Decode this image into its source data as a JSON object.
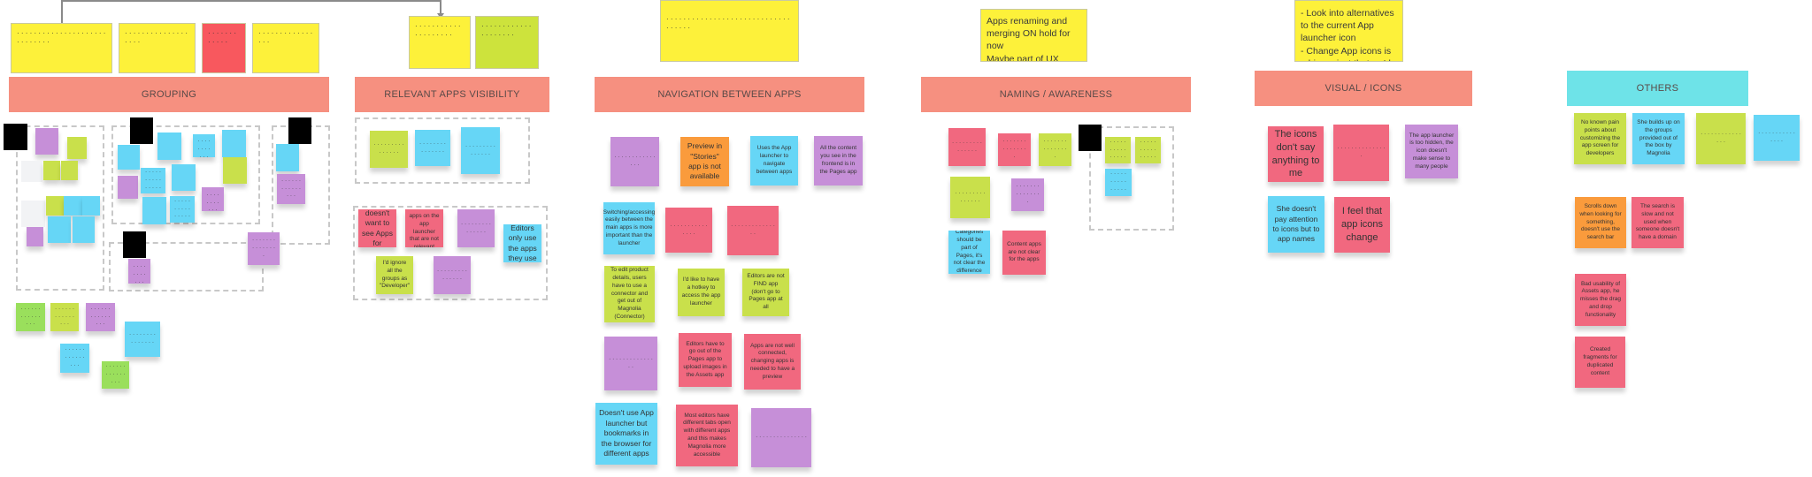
{
  "board": {
    "colors": {
      "header": "#f69080",
      "header_others": "#6ee3e8",
      "note_yellow": "#fdf13a",
      "note_red": "#f8585e",
      "note_lime": "#cde33c",
      "sticky_purple": "#c68fd8",
      "sticky_lime": "#c9e04b",
      "sticky_blue": "#66d6f6",
      "sticky_pink": "#f1687f",
      "sticky_orange": "#fa9b3c",
      "sticky_green": "#9adf5c"
    },
    "headers": {
      "grouping": "GROUPING",
      "relevant_apps_visibility": "RELEVANT APPS VISIBILITY",
      "navigation_between_apps": "NAVIGATION BETWEEN APPS",
      "naming_awareness": "NAMING / AWARENESS",
      "visual_icons": "VISUAL / ICONS",
      "others": "OTHERS"
    },
    "top_notes": {
      "grouping_1": "· · · · · · · · · · · · · · · · · · · · · · · · · · · · ·",
      "grouping_2": "· · · · · · · · · · · · · · · · · · ·",
      "grouping_3": "· · · · · · · · · · · ·",
      "grouping_4": "· · · · · · · · · · · · · · · ·",
      "relevant_1": "· · · · · · · · · · · · · · · · · · · ·",
      "relevant_2": "· · · · · · · · · · · · · · · · · · · ·",
      "navigation_1": "· · · · · · · · · · · · · · · · · · · · · · · · · · · · · · · · · · ·",
      "naming_1": "Apps renaming and merging ON hold for now\nMaybe part of UX writing scope?",
      "visual_1": "- Look into alternatives to the current App launcher icon\n- Change App icons is a big project that we'd need to outsource"
    },
    "illegible": "· · · · · · · · · · · · · · ·",
    "navigation": {
      "preview_stories": "Preview in \"Stories\" app is not available",
      "uses_app_launcher": "Uses the App launcher to navigate between apps",
      "all_content_pages": "All the content you see in the frontend is in the Pages app",
      "switching_quickly": "Switching/accessing easily between the main apps is more important than the launcher",
      "edit_product_details": "To edit product details, users have to use a connector and get out of Magnolia (Connector)",
      "hotkey_launcher": "I'd like to have a hotkey to access the app launcher",
      "editors_find_app": "Editors are not FIND app (don't go to Pages app at all",
      "leave_pages_app": "Editors have to go out of the Pages app to upload images in the Assets app",
      "apps_not_connected": "Apps are not well connected, changing apps is needed to have a preview",
      "bookmarks_browser": "Doesn't use App launcher but bookmarks in the browser for different apps",
      "most_editors_tabs": "Most editors have different tabs open with different apps and this makes Magnolia more accessible"
    },
    "visual": {
      "icons_dont_say": "The icons don't say anything to me",
      "pay_attention_names": "She doesn't pay attention to icons but to app names",
      "app_icons_change": "I feel that app icons change",
      "launcher_hidden": "The app launcher is too hidden, the icon doesn't make sense to many people"
    },
    "relevant": {
      "doesnt_want_apps": "She doesn't want to see Apps for developers",
      "editors_only_use": "Editors only use the apps they use",
      "ignore_groups": "I'd ignore all the groups as \"Developer\"",
      "apps_shown": "There are apps on the app launcher that are not relevant"
    },
    "naming": {
      "categories_group": "Categories should be part of Pages, it's not clear the difference",
      "content_apps_assets": "Content apps are not clear for the apps"
    },
    "others": {
      "no_known_pain": "No known pain points about customizing the app screen for developers",
      "builds_groups": "She builds up on the groups provided out of the box by Magnolia",
      "scrolls_down": "Scrolls down when looking for something, doesn't use the search bar",
      "poor_usability_assets": "Bad usability of Assets app, he misses the drag and drop functionality",
      "created_fragments": "Created fragments for duplicated content",
      "search_is_slow": "The search is slow and not used when someone doesn't have a domain"
    }
  }
}
